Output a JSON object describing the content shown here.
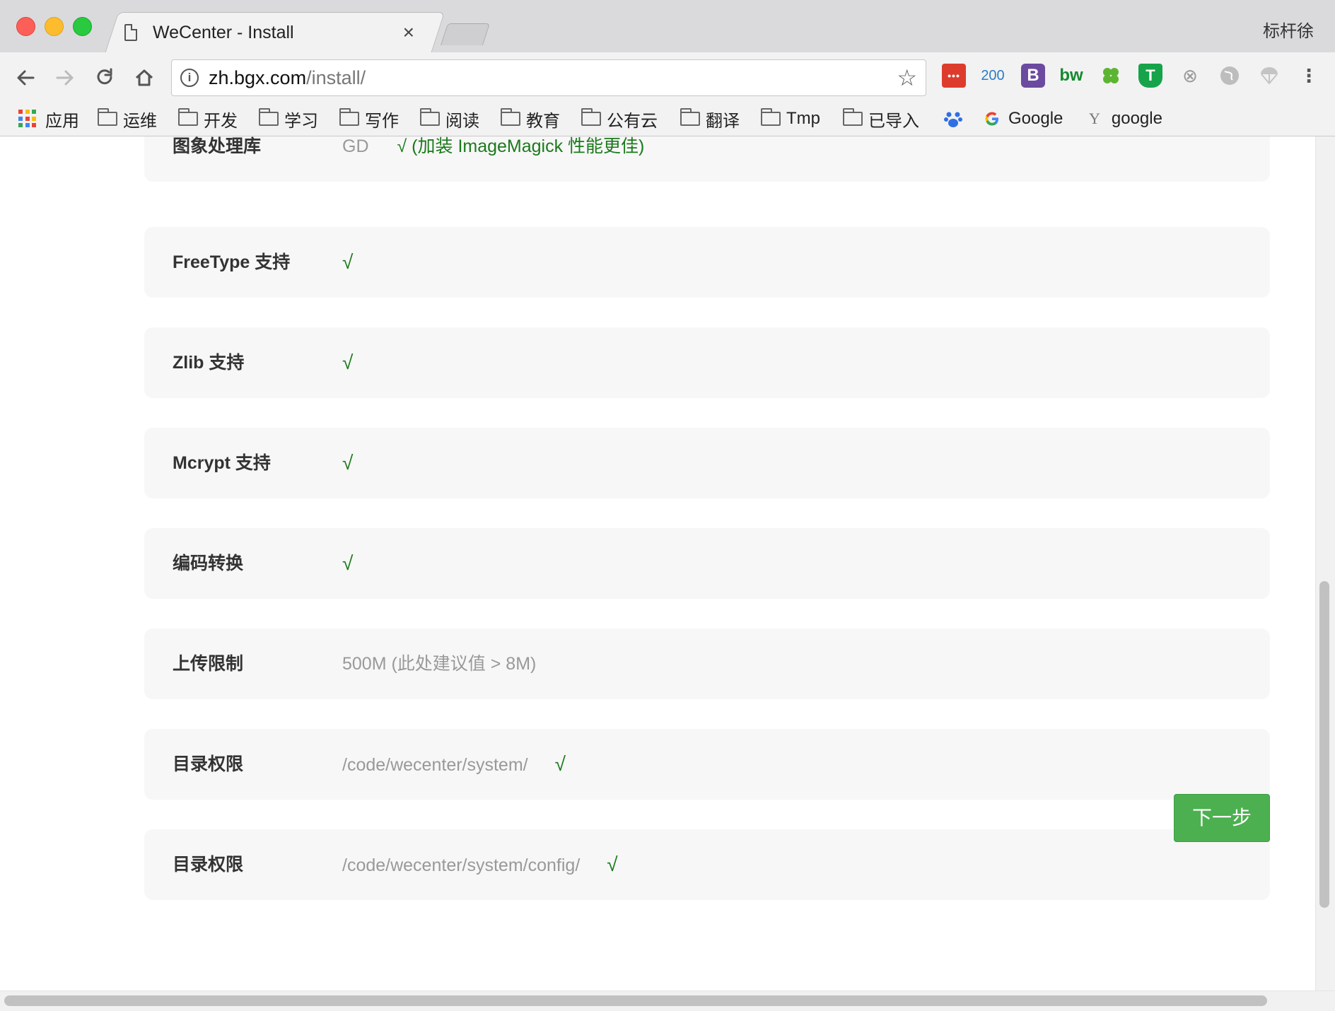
{
  "browser": {
    "tab_title": "WeCenter - Install",
    "profile_name": "标杆徐",
    "url_host": "zh.bgx.com",
    "url_path": "/install/",
    "extension_badge": "200",
    "ext_b": "B",
    "ext_bw": "bw",
    "ext_t": "T",
    "ext_dots": "•••"
  },
  "bookmarks": [
    {
      "label": "应用",
      "type": "apps"
    },
    {
      "label": "运维",
      "type": "folder"
    },
    {
      "label": "开发",
      "type": "folder"
    },
    {
      "label": "学习",
      "type": "folder"
    },
    {
      "label": "写作",
      "type": "folder"
    },
    {
      "label": "阅读",
      "type": "folder"
    },
    {
      "label": "教育",
      "type": "folder"
    },
    {
      "label": "公有云",
      "type": "folder"
    },
    {
      "label": "翻译",
      "type": "folder"
    },
    {
      "label": "Tmp",
      "type": "folder"
    },
    {
      "label": "已导入",
      "type": "folder"
    },
    {
      "label": "Google",
      "type": "google"
    },
    {
      "label": "google",
      "type": "yandex"
    }
  ],
  "checks": [
    {
      "label": "图象处理库",
      "value": "GD",
      "status": "√ (加装 ImageMagick 性能更佳)"
    },
    {
      "label": "FreeType 支持",
      "value": "",
      "status": "√"
    },
    {
      "label": "Zlib 支持",
      "value": "",
      "status": "√"
    },
    {
      "label": "Mcrypt 支持",
      "value": "",
      "status": "√"
    },
    {
      "label": "编码转换",
      "value": "",
      "status": "√"
    },
    {
      "label": "上传限制",
      "value": "500M (此处建议值 > 8M)",
      "status": ""
    },
    {
      "label": "目录权限",
      "value": "/code/wecenter/system/",
      "status": "√"
    },
    {
      "label": "目录权限",
      "value": "/code/wecenter/system/config/",
      "status": "√"
    }
  ],
  "next_button_label": "下一步",
  "colors": {
    "accent_green": "#4cb050",
    "check_green": "#1b7a1b",
    "row_bg": "#f7f7f7"
  }
}
